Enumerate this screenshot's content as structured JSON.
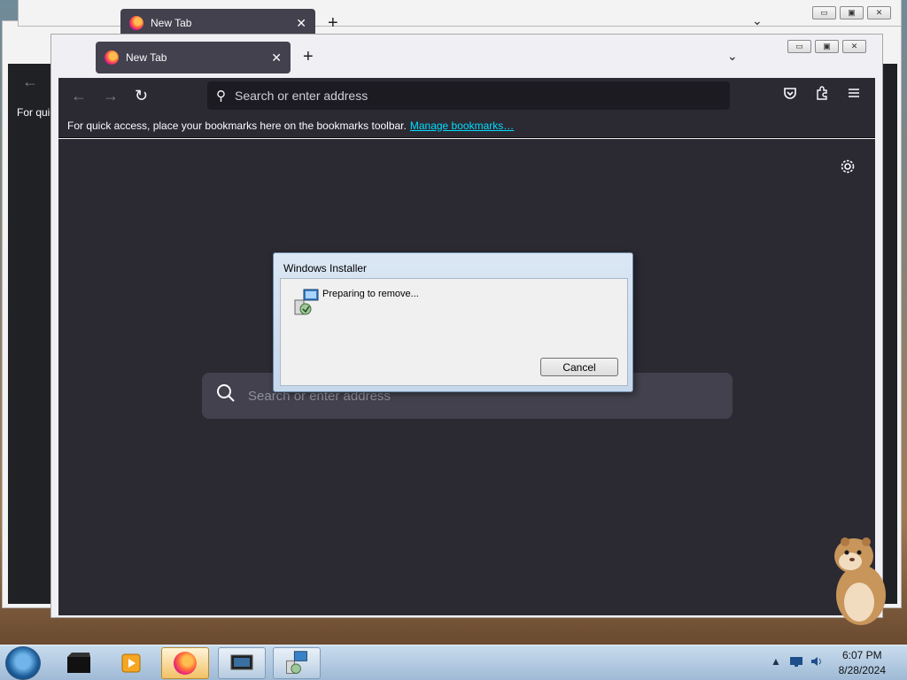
{
  "back_windows": {
    "tab_title": "New Tab",
    "bookmark_hint_fragment": "For quic"
  },
  "browser": {
    "tab_title": "New Tab",
    "new_tab_symbol": "+",
    "tab_close_symbol": "✕",
    "list_all_tabs_symbol": "⌄",
    "back_symbol": "←",
    "forward_symbol": "→",
    "reload_symbol": "↻",
    "urlbar_placeholder": "Search or enter address",
    "bookmarks_hint": "For quick access, place your bookmarks here on the bookmarks toolbar.",
    "manage_bookmarks_link": "Manage bookmarks…",
    "newtab_search_placeholder": "Search or enter address"
  },
  "window_controls": {
    "minimize": "▭",
    "maximize": "▣",
    "close": "✕"
  },
  "installer_dialog": {
    "title": "Windows Installer",
    "message": "Preparing to remove...",
    "cancel_label": "Cancel"
  },
  "taskbar": {
    "time": "6:07 PM",
    "date": "8/28/2024"
  },
  "colors": {
    "firefox_dark": "#2b2a33",
    "link": "#00ddff",
    "taskbar": "#b3cce4"
  }
}
